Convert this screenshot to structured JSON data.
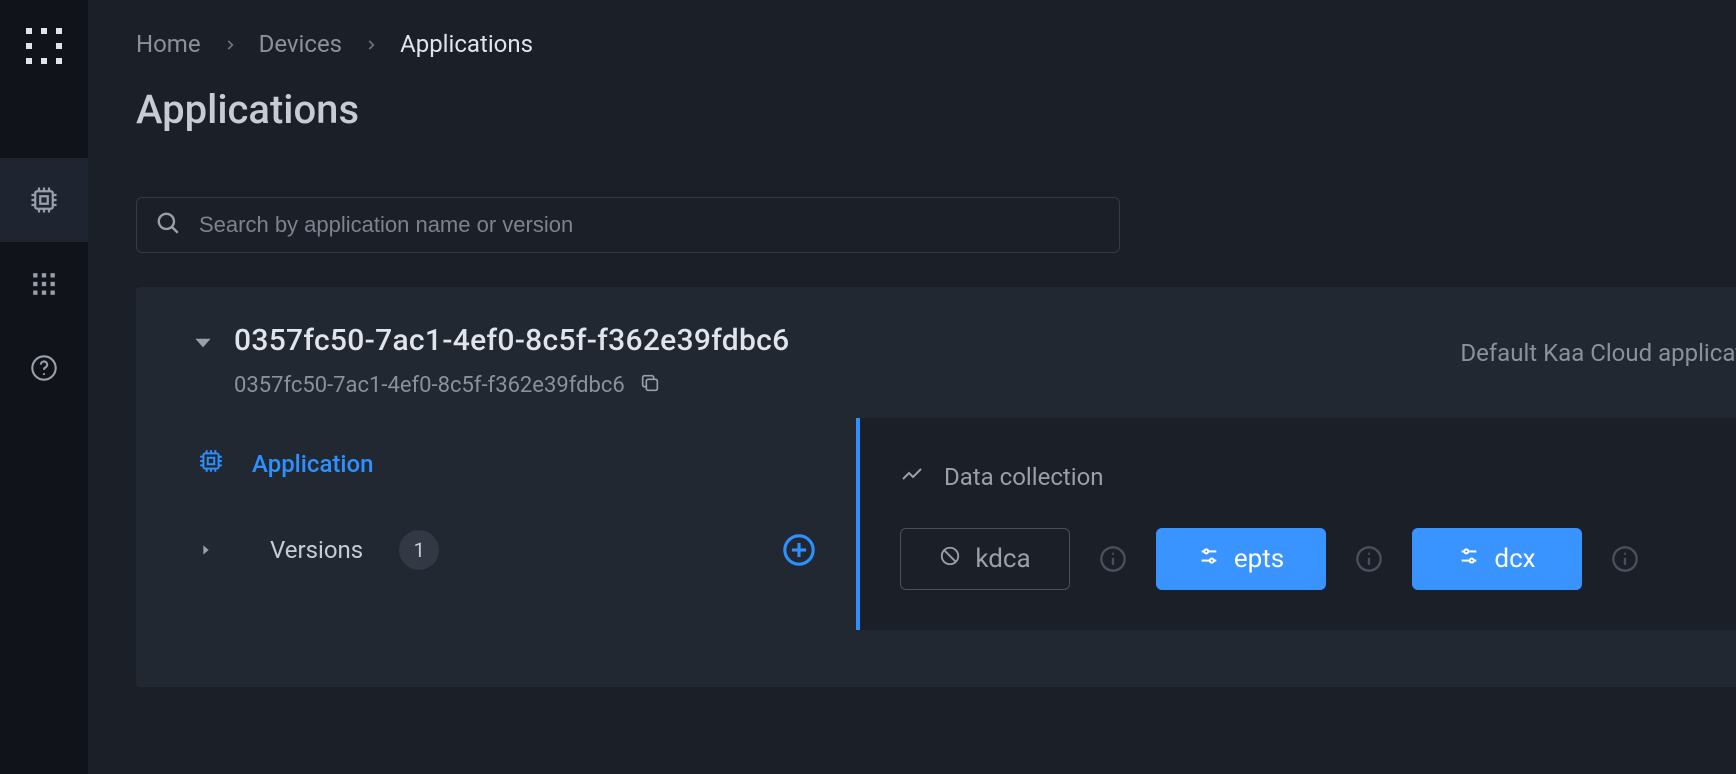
{
  "breadcrumb": {
    "home": "Home",
    "devices": "Devices",
    "applications": "Applications"
  },
  "page": {
    "title": "Applications"
  },
  "search": {
    "placeholder": "Search by application name or version"
  },
  "application": {
    "name": "0357fc50-7ac1-4ef0-8c5f-f362e39fdbc6",
    "id": "0357fc50-7ac1-4ef0-8c5f-f362e39fdbc6",
    "description": "Default Kaa Cloud application"
  },
  "tabs": {
    "application": "Application"
  },
  "versions": {
    "label": "Versions",
    "count": "1"
  },
  "section": {
    "data_collection": "Data collection"
  },
  "chips": {
    "kdca": "kdca",
    "epts": "epts",
    "dcx": "dcx"
  }
}
